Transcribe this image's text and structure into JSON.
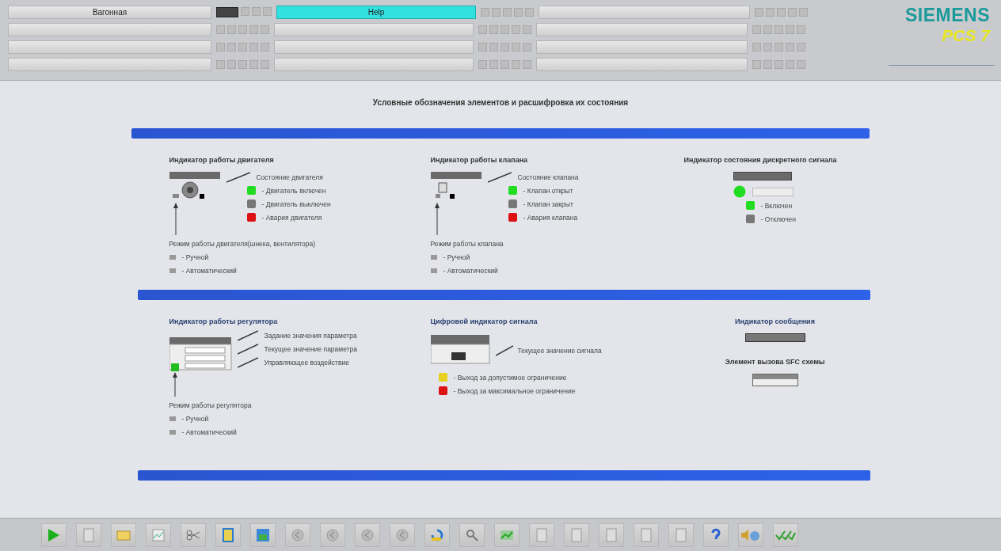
{
  "header": {
    "area_label": "Вагонная",
    "help_label": "Help"
  },
  "logo": {
    "brand": "SIEMENS",
    "product": "PCS 7"
  },
  "title": "Условные обозначения элементов и расшифровка их состояния",
  "sections": [
    {
      "kind": "motor",
      "heading": "Индикатор работы двигателя",
      "state_label": "Состояние двигателя",
      "legend": [
        {
          "color": "#22dd22",
          "text": "- Двигатель включен"
        },
        {
          "color": "#777777",
          "text": "- Двигатель выключен"
        },
        {
          "color": "#dd1111",
          "text": "- Авария двигателя"
        }
      ],
      "mode_title": "Режим работы двигателя(шнека, вентилятора)",
      "modes": [
        "- Ручной",
        "- Автоматический"
      ]
    },
    {
      "kind": "valve",
      "heading": "Индикатор работы клапана",
      "state_label": "Состояние клапана",
      "legend": [
        {
          "color": "#22dd22",
          "text": "- Клапан открыт"
        },
        {
          "color": "#777777",
          "text": "- Клапан закрыт"
        },
        {
          "color": "#dd1111",
          "text": "- Авария клапана"
        }
      ],
      "mode_title": "Режим работы клапана",
      "modes": [
        "- Ручной",
        "- Автоматический"
      ]
    },
    {
      "kind": "digital",
      "heading": "Индикатор состояния дискретного сигнала",
      "legend": [
        {
          "color": "#22dd22",
          "text": "- Включен"
        },
        {
          "color": "#777777",
          "text": "- Отключен"
        }
      ]
    },
    {
      "kind": "controller",
      "heading": "Индикатор работы регулятора",
      "callouts": [
        "Задание значения параметра",
        "Текущее значение параметра",
        "Управляющее воздействие"
      ],
      "mode_title": "Режим работы регулятора",
      "modes": [
        "- Ручной",
        "- Автоматический"
      ]
    },
    {
      "kind": "numeric",
      "heading": "Цифровой индикатор сигнала",
      "state_label": "Текущее значение сигнала",
      "legend": [
        {
          "color": "#e8d020",
          "text": "- Выход за допустимое ограничение"
        },
        {
          "color": "#dd1111",
          "text": "- Выход за максимальное ограничение"
        }
      ]
    },
    {
      "kind": "message",
      "heading": "Индикатор сообщения",
      "sfc_label": "Элемент вызова SFC схемы"
    }
  ],
  "toolbar": [
    {
      "kind": "play"
    },
    {
      "kind": "doc"
    },
    {
      "kind": "folder"
    },
    {
      "kind": "graph"
    },
    {
      "kind": "tool"
    },
    {
      "kind": "book"
    },
    {
      "kind": "image"
    },
    {
      "kind": "nav"
    },
    {
      "kind": "nav"
    },
    {
      "kind": "nav"
    },
    {
      "kind": "nav"
    },
    {
      "kind": "undo"
    },
    {
      "kind": "zoom"
    },
    {
      "kind": "green"
    },
    {
      "kind": "doc"
    },
    {
      "kind": "doc"
    },
    {
      "kind": "doc"
    },
    {
      "kind": "doc"
    },
    {
      "kind": "doc"
    },
    {
      "kind": "help"
    },
    {
      "kind": "sound"
    },
    {
      "kind": "check"
    }
  ]
}
